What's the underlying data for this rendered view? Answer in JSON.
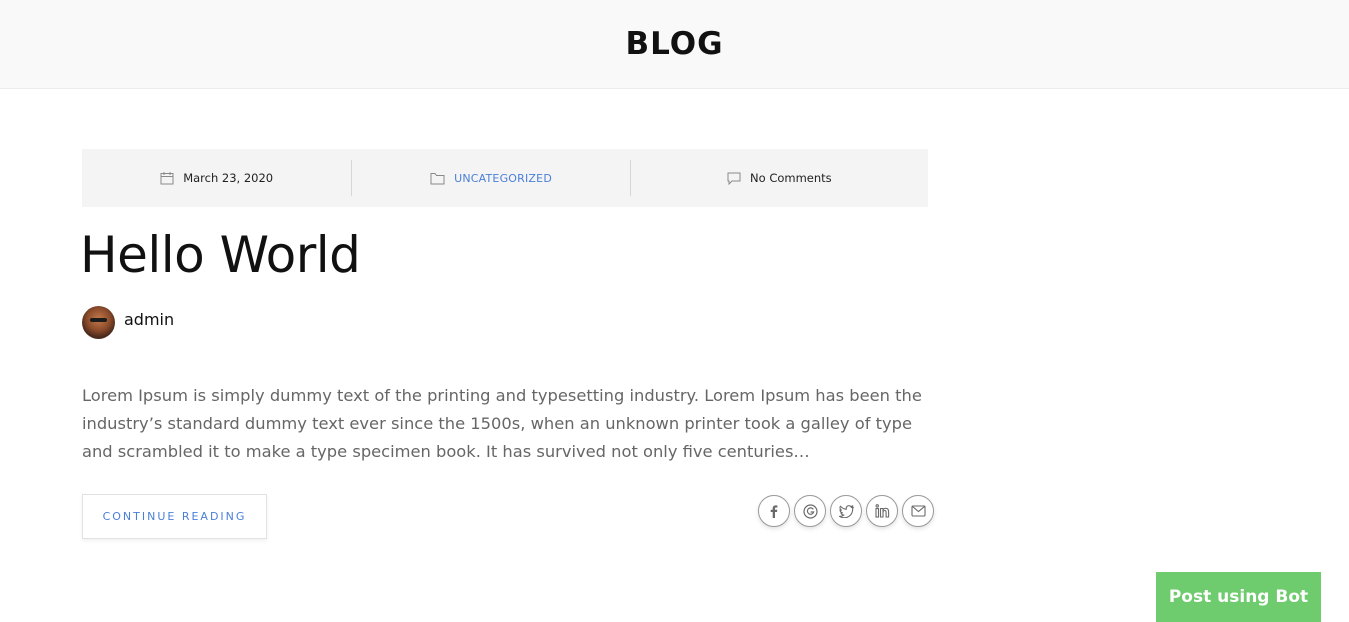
{
  "header": {
    "title": "BLOG"
  },
  "post": {
    "meta": {
      "date": "March 23, 2020",
      "category": "UNCATEGORIZED",
      "comments": "No Comments"
    },
    "title": "Hello World",
    "author": "admin",
    "excerpt": "Lorem Ipsum is simply dummy text of the printing and typesetting industry. Lorem Ipsum has been the industry’s standard dummy text ever since the 1500s, when an unknown printer took a galley of type and scrambled it to make a type specimen book. It has survived not only five centuries…",
    "continue_label": "CONTINUE READING",
    "share_icons": [
      "facebook-icon",
      "google-icon",
      "twitter-icon",
      "linkedin-icon",
      "email-icon"
    ]
  },
  "bot_button": {
    "label": "Post using Bot"
  },
  "colors": {
    "accent": "#4a7fd8",
    "bot_green": "#6ecb6e",
    "meta_bg": "#f4f4f4",
    "header_bg": "#f9f9f9"
  }
}
